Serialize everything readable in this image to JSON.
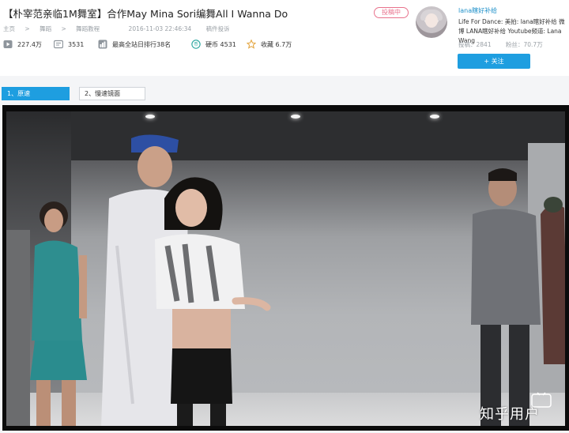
{
  "video": {
    "title": "【朴宰范亲临1M舞室】合作May Mina Sori编舞All I Wanna Do",
    "badge": "投稿中",
    "breadcrumb": [
      "主页",
      "舞蹈",
      "舞蹈教程"
    ],
    "breadcrumb_sep": ">",
    "date": "2016-11-03 22:46:34",
    "report": "稿件投诉"
  },
  "stats": {
    "plays": "227.4万",
    "danmaku": "3531",
    "rank": "最高全站日排行38名",
    "coins": "硬币 4531",
    "favorites": "收藏 6.7万"
  },
  "uploader": {
    "name": "lana瞎好补给",
    "desc": "Life For Dance: 美拍: lana瞎好补给 微博 LANA瞎好补给 Youtube频道: Lana Wang",
    "submissions": "投稿：2841",
    "fans": "粉丝：70.7万",
    "follow_label": "+ 关注"
  },
  "parts": [
    {
      "label": "1、原速"
    },
    {
      "label": "2、慢速镜面"
    }
  ],
  "watermark": "知乎用户",
  "colors": {
    "accent": "#1e9ee0",
    "link": "#1e90c9",
    "badge": "#e8728c"
  },
  "icons": [
    "play-count-icon",
    "danmaku-icon",
    "rank-icon",
    "coin-icon",
    "favorite-star-icon"
  ]
}
